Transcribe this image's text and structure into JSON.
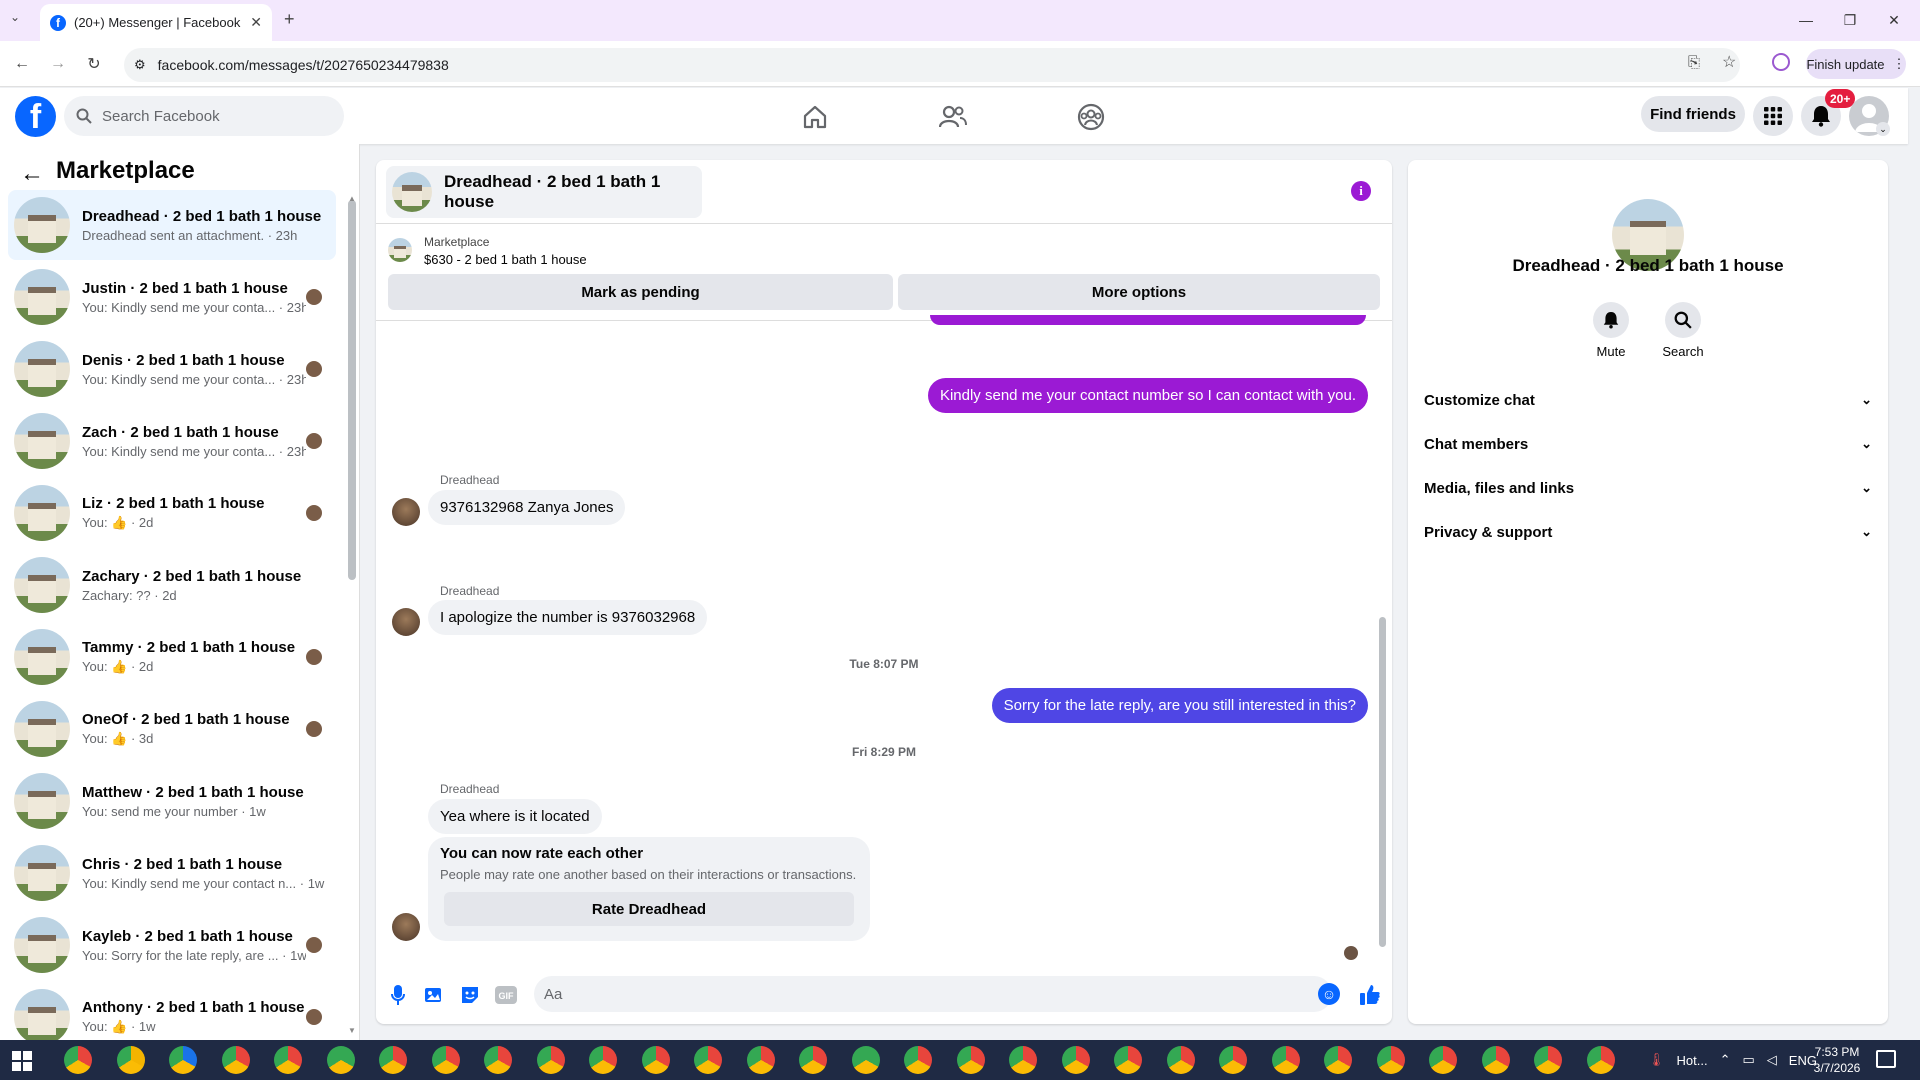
{
  "browser": {
    "tab_title": "(20+) Messenger | Facebook",
    "url": "facebook.com/messages/t/2027650234479838",
    "finish_update": "Finish update"
  },
  "header": {
    "search_placeholder": "Search Facebook",
    "find_friends": "Find friends",
    "notifications_badge": "20+"
  },
  "sidebar": {
    "title": "Marketplace",
    "conversations": [
      {
        "name": "Dreadhead · 2 bed 1 bath 1 house",
        "preview": "Dreadhead sent an attachment. · 23h"
      },
      {
        "name": "Justin · 2 bed 1 bath 1 house",
        "preview": "You: Kindly send me your conta... · 23h"
      },
      {
        "name": "Denis · 2 bed 1 bath 1 house",
        "preview": "You: Kindly send me your conta... · 23h"
      },
      {
        "name": "Zach · 2 bed 1 bath 1 house",
        "preview": "You: Kindly send me your conta... · 23h"
      },
      {
        "name": "Liz · 2 bed 1 bath 1 house",
        "preview": "You: 👍 · 2d"
      },
      {
        "name": "Zachary · 2 bed 1 bath 1 house",
        "preview": "Zachary: ?? · 2d"
      },
      {
        "name": "Tammy · 2 bed 1 bath 1 house",
        "preview": "You: 👍 · 2d"
      },
      {
        "name": "OneOf · 2 bed 1 bath 1 house",
        "preview": "You: 👍 · 3d"
      },
      {
        "name": "Matthew · 2 bed 1 bath 1 house",
        "preview": "You: send me your number · 1w"
      },
      {
        "name": "Chris · 2 bed 1 bath 1 house",
        "preview": "You: Kindly send me your contact n... · 1w"
      },
      {
        "name": "Kayleb · 2 bed 1 bath 1 house",
        "preview": "You: Sorry for the late reply, are ... · 1w"
      },
      {
        "name": "Anthony · 2 bed 1 bath 1 house",
        "preview": "You: 👍 · 1w"
      }
    ]
  },
  "chat": {
    "title": "Dreadhead · 2 bed 1 bath 1 house",
    "listing_label": "Marketplace",
    "listing_price": "$630 - 2 bed 1 bath 1 house",
    "mark_pending": "Mark as pending",
    "more_options": "More options",
    "messages": {
      "out1": "Kindly send me your contact number so I can contact with you.",
      "sender": "Dreadhead",
      "in1": "9376132968 Zanya Jones",
      "in2": "I apologize the number is 9376032968",
      "ts1": "Tue 8:07 PM",
      "out2": "Sorry for the late reply, are you still interested in this?",
      "ts2": "Fri 8:29 PM",
      "in3": "Yea where is it located"
    },
    "rate_card": {
      "title": "You can now rate each other",
      "subtitle": "People may rate one another based on their interactions or transactions.",
      "button": "Rate Dreadhead"
    },
    "composer_placeholder": "Aa"
  },
  "details": {
    "title": "Dreadhead · 2 bed 1 bath 1 house",
    "mute": "Mute",
    "search": "Search",
    "sections": [
      "Customize chat",
      "Chat members",
      "Media, files and links",
      "Privacy & support"
    ]
  },
  "taskbar": {
    "tray_app": "Hot...",
    "lang": "ENG",
    "time": "7:53 PM",
    "date": "3/7/2026"
  },
  "colors": {
    "fb_blue": "#0866ff",
    "bubble_purple": "#9b1ad4",
    "bubble_blue": "#4f46e5"
  }
}
